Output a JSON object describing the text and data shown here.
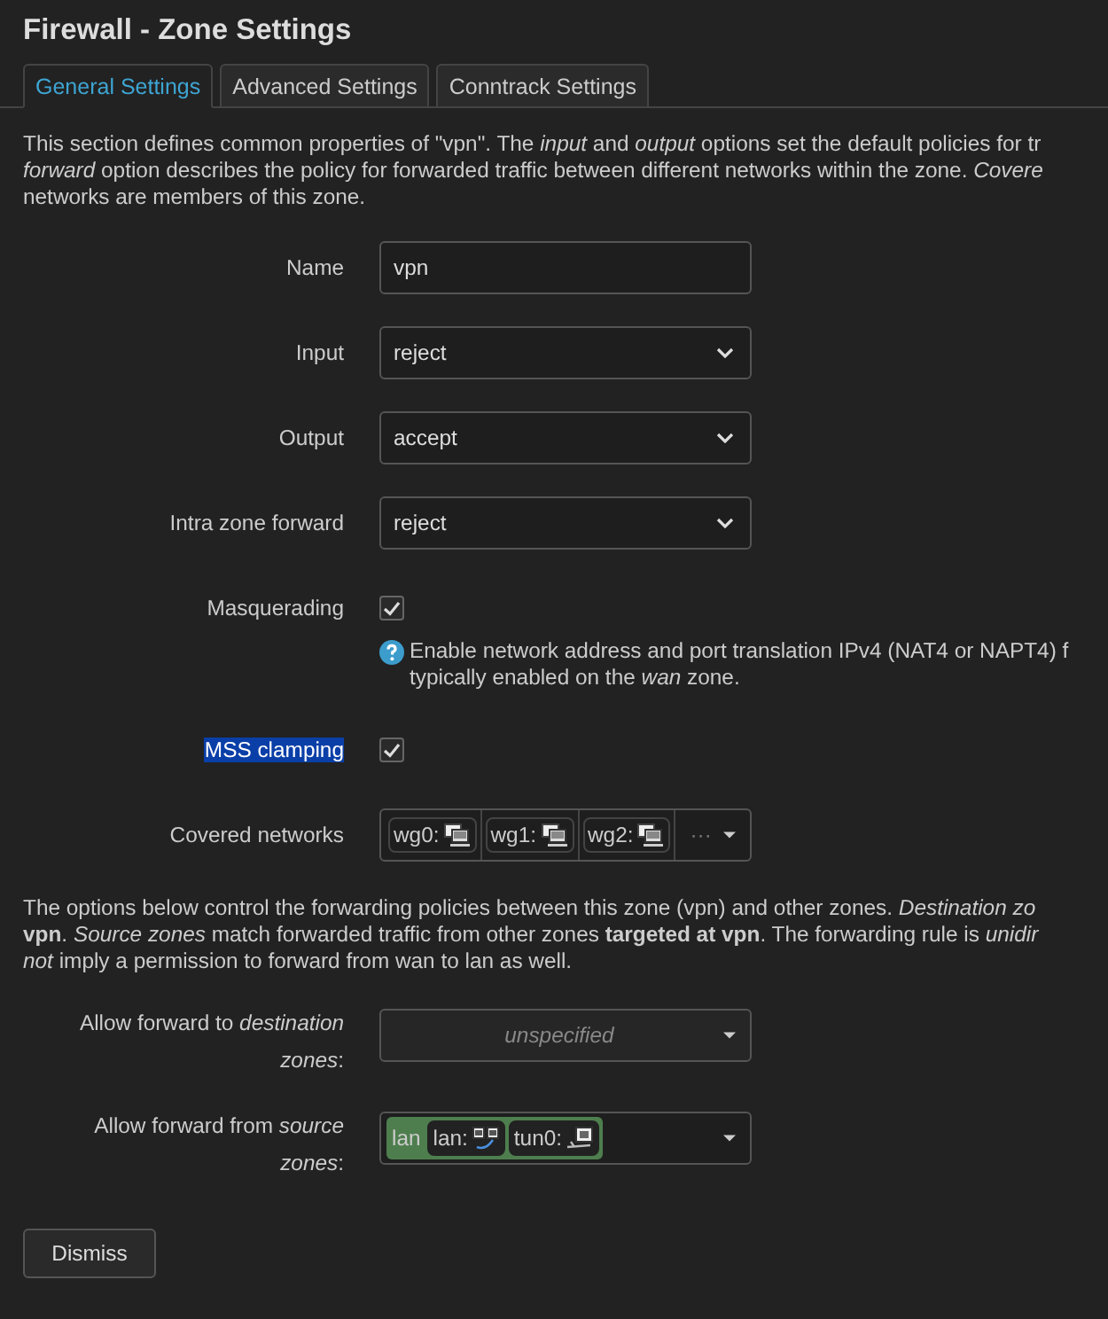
{
  "title": "Firewall - Zone Settings",
  "tabs": [
    {
      "label": "General Settings",
      "selected": true
    },
    {
      "label": "Advanced Settings",
      "selected": false
    },
    {
      "label": "Conntrack Settings",
      "selected": false
    }
  ],
  "intro": [
    "This section defines common properties of \"vpn\". The *input* and *output* options set the default policies for tr",
    "*forward* option describes the policy for forwarded traffic between different networks within the zone. *Covere*",
    "networks are members of this zone."
  ],
  "fields": [
    {
      "kind": "text",
      "label": "Name",
      "value": "vpn"
    },
    {
      "kind": "select",
      "label": "Input",
      "value": "reject"
    },
    {
      "kind": "select",
      "label": "Output",
      "value": "accept"
    },
    {
      "kind": "select",
      "label": "Intra zone forward",
      "value": "reject"
    },
    {
      "kind": "checkbox",
      "label": "Masquerading",
      "checked": true,
      "highlighted": false,
      "help": [
        "Enable network address and port translation IPv4 (NAT4 or NAPT4) f",
        "typically enabled on the *wan* zone."
      ]
    },
    {
      "kind": "checkbox",
      "label": "MSS clamping",
      "checked": true,
      "highlighted": true
    },
    {
      "kind": "networks",
      "label": "Covered networks",
      "chips": [
        "wg0:",
        "wg1:",
        "wg2:"
      ],
      "more": "···"
    }
  ],
  "forwarding_intro": [
    "The options below control the forwarding policies between this zone (vpn) and other zones. *Destination zo*",
    "**vpn**. *Source zones* match forwarded traffic from other zones **targeted at vpn**. The forwarding rule is *unidir*",
    "*not* imply a permission to forward from wan to lan as well."
  ],
  "forwarding": [
    {
      "label": "Allow forward to *destination* *zones*:",
      "placeholder": "unspecified"
    },
    {
      "label": "Allow forward from *source* *zones*:",
      "zone": "lan",
      "chips": [
        {
          "kind": "lan",
          "text": "lan:"
        },
        {
          "kind": "tunnel",
          "text": "tun0:"
        }
      ]
    }
  ],
  "dismiss": "Dismiss"
}
